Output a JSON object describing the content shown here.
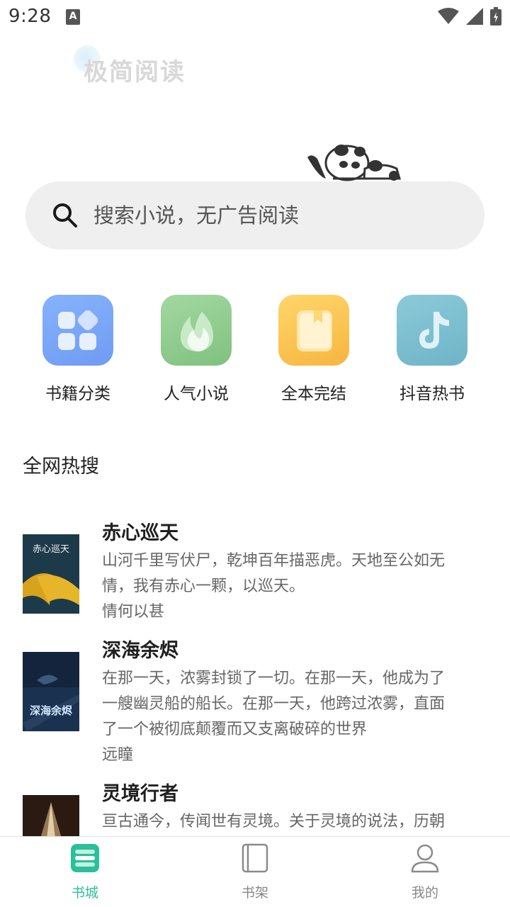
{
  "status_bar": {
    "time": "9:28",
    "notification_icon": "a-icon"
  },
  "app": {
    "logo_text": "极简阅读"
  },
  "search": {
    "placeholder": "搜索小说，无广告阅读"
  },
  "categories": [
    {
      "label": "书籍分类",
      "icon": "grid-icon",
      "color": "#7aa6f7"
    },
    {
      "label": "人气小说",
      "icon": "flame-icon",
      "color": "#8bc98a"
    },
    {
      "label": "全本完结",
      "icon": "book-icon",
      "color": "#fcc552"
    },
    {
      "label": "抖音热书",
      "icon": "music-note-icon",
      "color": "#7cbdcf"
    }
  ],
  "section": {
    "title": "全网热搜"
  },
  "books": [
    {
      "title": "赤心巡天",
      "desc_line1": "山河千里写伏尸，乾坤百年描恶虎。天地至公如无",
      "desc_line2": "情，我有赤心一颗，以巡天。",
      "desc_line3": "",
      "author": "情何以甚",
      "cover_title": "赤心巡天"
    },
    {
      "title": "深海余烬",
      "desc_line1": "在那一天，浓雾封锁了一切。在那一天，他成为了",
      "desc_line2": "一艘幽灵船的船长。在那一天，他跨过浓雾，直面",
      "desc_line3": "了一个被彻底颠覆而又支离破碎的世界",
      "author": "远瞳",
      "cover_title": "深海余烬"
    },
    {
      "title": "灵境行者",
      "desc_line1": "亘古通今，传闻世有灵境。关于灵境的说法，历朝",
      "desc_line2": "",
      "desc_line3": "",
      "author": "",
      "cover_title": ""
    }
  ],
  "bottom_nav": [
    {
      "label": "书城",
      "icon": "bookstore-icon",
      "active": true
    },
    {
      "label": "书架",
      "icon": "bookshelf-icon",
      "active": false
    },
    {
      "label": "我的",
      "icon": "profile-icon",
      "active": false
    }
  ],
  "colors": {
    "accent": "#2bbf9a",
    "search_bg": "#efefef"
  }
}
